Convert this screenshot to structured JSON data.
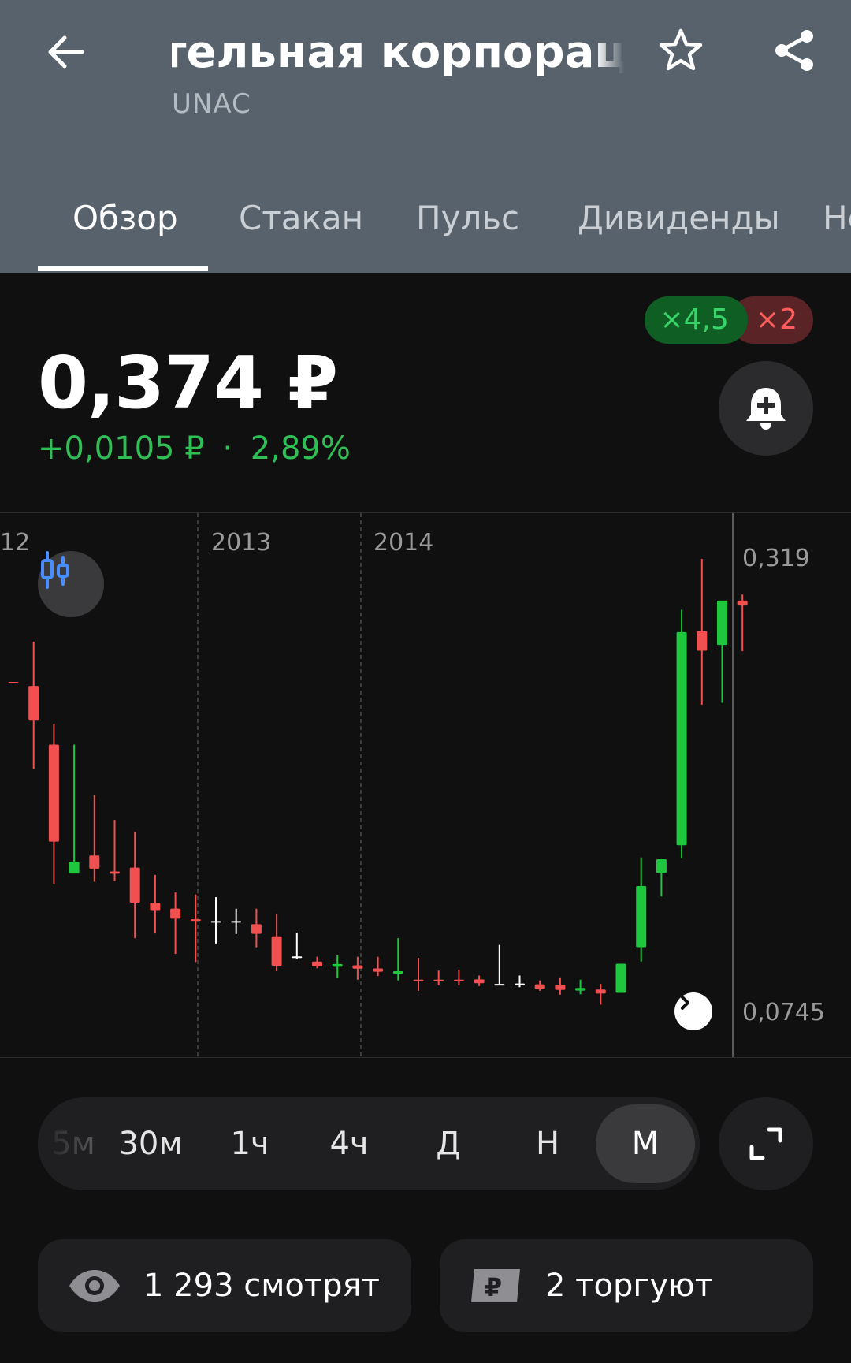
{
  "header": {
    "title": "тельная корпорация",
    "ticker": "UNAC",
    "icons": {
      "back": "arrow-left-icon",
      "favorite": "star-outline-icon",
      "share": "share-icon"
    }
  },
  "tabs": [
    {
      "label": "Обзор",
      "active": true
    },
    {
      "label": "Стакан",
      "active": false
    },
    {
      "label": "Пульс",
      "active": false
    },
    {
      "label": "Дивиденды",
      "active": false
    },
    {
      "label": "Но",
      "active": false
    }
  ],
  "quote": {
    "price": "0,374 ₽",
    "change_abs": "+0,0105 ₽",
    "separator": "·",
    "change_pct": "2,89%",
    "change_color": "#2fbf55",
    "leverage_long": "×4,5",
    "leverage_short": "×2"
  },
  "chart": {
    "x_labels": [
      "12",
      "2013",
      "2014"
    ],
    "price_labels": [
      "0,319",
      "0,0745"
    ],
    "colors": {
      "up": "#1fc73e",
      "down": "#f25050",
      "doji": "#ffffff"
    },
    "candles": [
      {
        "o": 0.2515,
        "h": 0.2515,
        "l": 0.2515,
        "c": 0.2515,
        "dir": "down"
      },
      {
        "o": 0.2493,
        "h": 0.2735,
        "l": 0.2037,
        "c": 0.2306,
        "dir": "down"
      },
      {
        "o": 0.2171,
        "h": 0.2284,
        "l": 0.1405,
        "c": 0.1638,
        "dir": "down"
      },
      {
        "o": 0.1463,
        "h": 0.2171,
        "l": 0.1469,
        "c": 0.1528,
        "dir": "up"
      },
      {
        "o": 0.1562,
        "h": 0.1894,
        "l": 0.1418,
        "c": 0.149,
        "dir": "down"
      },
      {
        "o": 0.1474,
        "h": 0.1757,
        "l": 0.1421,
        "c": 0.1462,
        "dir": "down"
      },
      {
        "o": 0.1495,
        "h": 0.169,
        "l": 0.1108,
        "c": 0.1303,
        "dir": "down"
      },
      {
        "o": 0.1301,
        "h": 0.1455,
        "l": 0.1134,
        "c": 0.1262,
        "dir": "down"
      },
      {
        "o": 0.127,
        "h": 0.1359,
        "l": 0.1022,
        "c": 0.1215,
        "dir": "down"
      },
      {
        "o": 0.1212,
        "h": 0.1348,
        "l": 0.0977,
        "c": 0.1207,
        "dir": "down"
      },
      {
        "o": 0.1202,
        "h": 0.1333,
        "l": 0.1079,
        "c": 0.1202,
        "dir": "doji"
      },
      {
        "o": 0.1202,
        "h": 0.127,
        "l": 0.1131,
        "c": 0.1202,
        "dir": "doji"
      },
      {
        "o": 0.1185,
        "h": 0.127,
        "l": 0.1058,
        "c": 0.1132,
        "dir": "down"
      },
      {
        "o": 0.1118,
        "h": 0.1239,
        "l": 0.0927,
        "c": 0.0957,
        "dir": "down"
      },
      {
        "o": 0.1008,
        "h": 0.1139,
        "l": 0.0992,
        "c": 0.1008,
        "dir": "doji"
      },
      {
        "o": 0.098,
        "h": 0.1006,
        "l": 0.0943,
        "c": 0.0953,
        "dir": "down"
      },
      {
        "o": 0.0951,
        "h": 0.1013,
        "l": 0.0891,
        "c": 0.0966,
        "dir": "up"
      },
      {
        "o": 0.0959,
        "h": 0.1006,
        "l": 0.088,
        "c": 0.0941,
        "dir": "down"
      },
      {
        "o": 0.0942,
        "h": 0.1006,
        "l": 0.09,
        "c": 0.0924,
        "dir": "down"
      },
      {
        "o": 0.0914,
        "h": 0.1108,
        "l": 0.0876,
        "c": 0.0927,
        "dir": "up"
      },
      {
        "o": 0.088,
        "h": 0.1,
        "l": 0.0819,
        "c": 0.088,
        "dir": "down"
      },
      {
        "o": 0.088,
        "h": 0.093,
        "l": 0.0849,
        "c": 0.088,
        "dir": "down"
      },
      {
        "o": 0.088,
        "h": 0.0935,
        "l": 0.0849,
        "c": 0.088,
        "dir": "down"
      },
      {
        "o": 0.0882,
        "h": 0.0903,
        "l": 0.0845,
        "c": 0.0861,
        "dir": "down"
      },
      {
        "o": 0.0857,
        "h": 0.1071,
        "l": 0.0857,
        "c": 0.0857,
        "dir": "doji"
      },
      {
        "o": 0.0859,
        "h": 0.0903,
        "l": 0.0839,
        "c": 0.0859,
        "dir": "doji"
      },
      {
        "o": 0.0855,
        "h": 0.0876,
        "l": 0.0819,
        "c": 0.0829,
        "dir": "down"
      },
      {
        "o": 0.0853,
        "h": 0.0893,
        "l": 0.0798,
        "c": 0.0824,
        "dir": "down"
      },
      {
        "o": 0.082,
        "h": 0.088,
        "l": 0.08,
        "c": 0.0835,
        "dir": "up"
      },
      {
        "o": 0.0826,
        "h": 0.0857,
        "l": 0.0743,
        "c": 0.0804,
        "dir": "down"
      },
      {
        "o": 0.0808,
        "h": 0.0967,
        "l": 0.0808,
        "c": 0.0968,
        "dir": "up"
      },
      {
        "o": 0.1059,
        "h": 0.1551,
        "l": 0.098,
        "c": 0.1394,
        "dir": "up"
      },
      {
        "o": 0.1466,
        "h": 0.153,
        "l": 0.1337,
        "c": 0.1541,
        "dir": "up"
      },
      {
        "o": 0.1618,
        "h": 0.2911,
        "l": 0.1547,
        "c": 0.2788,
        "dir": "up"
      },
      {
        "o": 0.2793,
        "h": 0.319,
        "l": 0.239,
        "c": 0.2686,
        "dir": "down"
      },
      {
        "o": 0.2718,
        "h": 0.2904,
        "l": 0.24,
        "c": 0.2961,
        "dir": "up"
      },
      {
        "o": 0.2961,
        "h": 0.2994,
        "l": 0.2683,
        "c": 0.2934,
        "dir": "down"
      }
    ]
  },
  "intervals": [
    {
      "label": "5м",
      "faded": true,
      "selected": false
    },
    {
      "label": "30м",
      "faded": false,
      "selected": false
    },
    {
      "label": "1ч",
      "faded": false,
      "selected": false
    },
    {
      "label": "4ч",
      "faded": false,
      "selected": false
    },
    {
      "label": "Д",
      "faded": false,
      "selected": false
    },
    {
      "label": "Н",
      "faded": false,
      "selected": false
    },
    {
      "label": "М",
      "faded": false,
      "selected": true
    }
  ],
  "stats": {
    "watching": "1 293 смотрят",
    "trading": "2 торгуют"
  }
}
